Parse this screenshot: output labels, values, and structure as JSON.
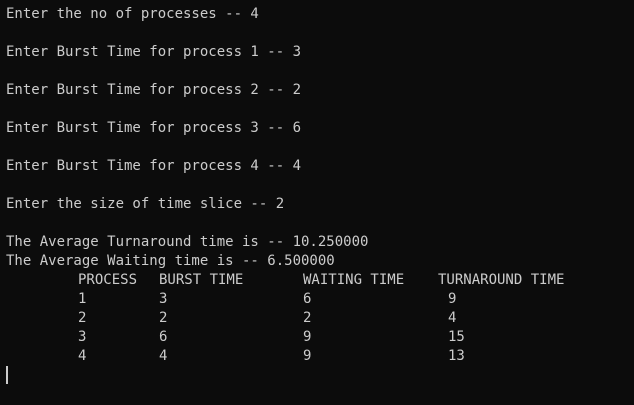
{
  "prompts": [
    "Enter the no of processes -- 4",
    "Enter Burst Time for process 1 -- 3",
    "Enter Burst Time for process 2 -- 2",
    "Enter Burst Time for process 3 -- 6",
    "Enter Burst Time for process 4 -- 4",
    "Enter the size of time slice -- 2"
  ],
  "results": {
    "avg_turnaround": "The Average Turnaround time is -- 10.250000",
    "avg_waiting": "The Average Waiting time is -- 6.500000"
  },
  "table": {
    "headers": [
      "PROCESS",
      "BURST TIME",
      "WAITING TIME",
      "TURNAROUND TIME"
    ],
    "rows": [
      [
        "1",
        "3",
        "6",
        "9"
      ],
      [
        "2",
        "2",
        "2",
        "4"
      ],
      [
        "3",
        "6",
        "9",
        "15"
      ],
      [
        "4",
        "4",
        "9",
        "13"
      ]
    ]
  },
  "colors": {
    "background": "#0c0c0c",
    "foreground": "#cccccc"
  }
}
